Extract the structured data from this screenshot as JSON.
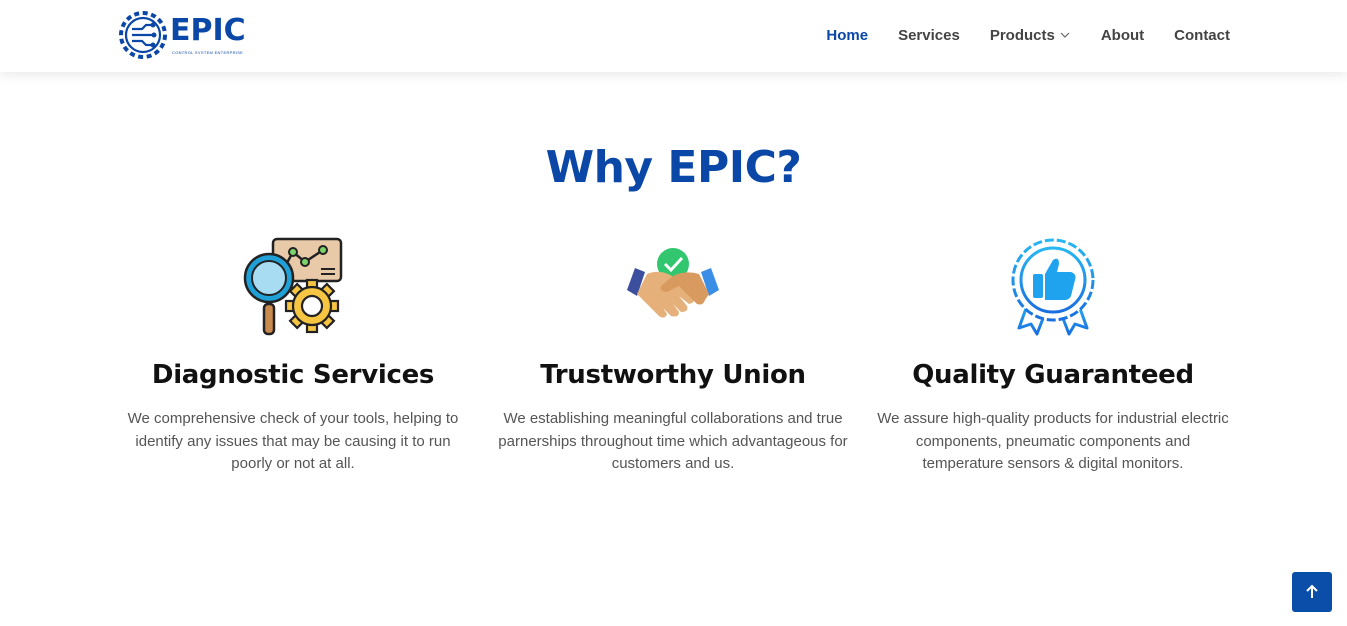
{
  "brand": {
    "name": "EPIC",
    "tagline": "CONTROL SYSTEM ENTERPRISE",
    "color": "#0b47a6"
  },
  "nav": {
    "items": [
      {
        "label": "Home",
        "active": true
      },
      {
        "label": "Services",
        "active": false
      },
      {
        "label": "Products",
        "active": false,
        "has_dropdown": true
      },
      {
        "label": "About",
        "active": false
      },
      {
        "label": "Contact",
        "active": false
      }
    ]
  },
  "section": {
    "title": "Why EPIC?"
  },
  "features": [
    {
      "icon": "diagnostic-icon",
      "title": "Diagnostic Services",
      "description": "We comprehensive check of your tools, helping to identify any issues that may be causing it to run poorly or not at all."
    },
    {
      "icon": "handshake-icon",
      "title": "Trustworthy Union",
      "description": "We establishing meaningful collaborations and true parnerships throughout time which advantageous for customers and us."
    },
    {
      "icon": "quality-badge-icon",
      "title": "Quality Guaranteed",
      "description": "We assure high-quality products for industrial electric components, pneumatic components and temperature sensors & digital monitors."
    }
  ],
  "back_to_top": {
    "icon": "arrow-up-icon",
    "color": "#0b4ea9"
  }
}
